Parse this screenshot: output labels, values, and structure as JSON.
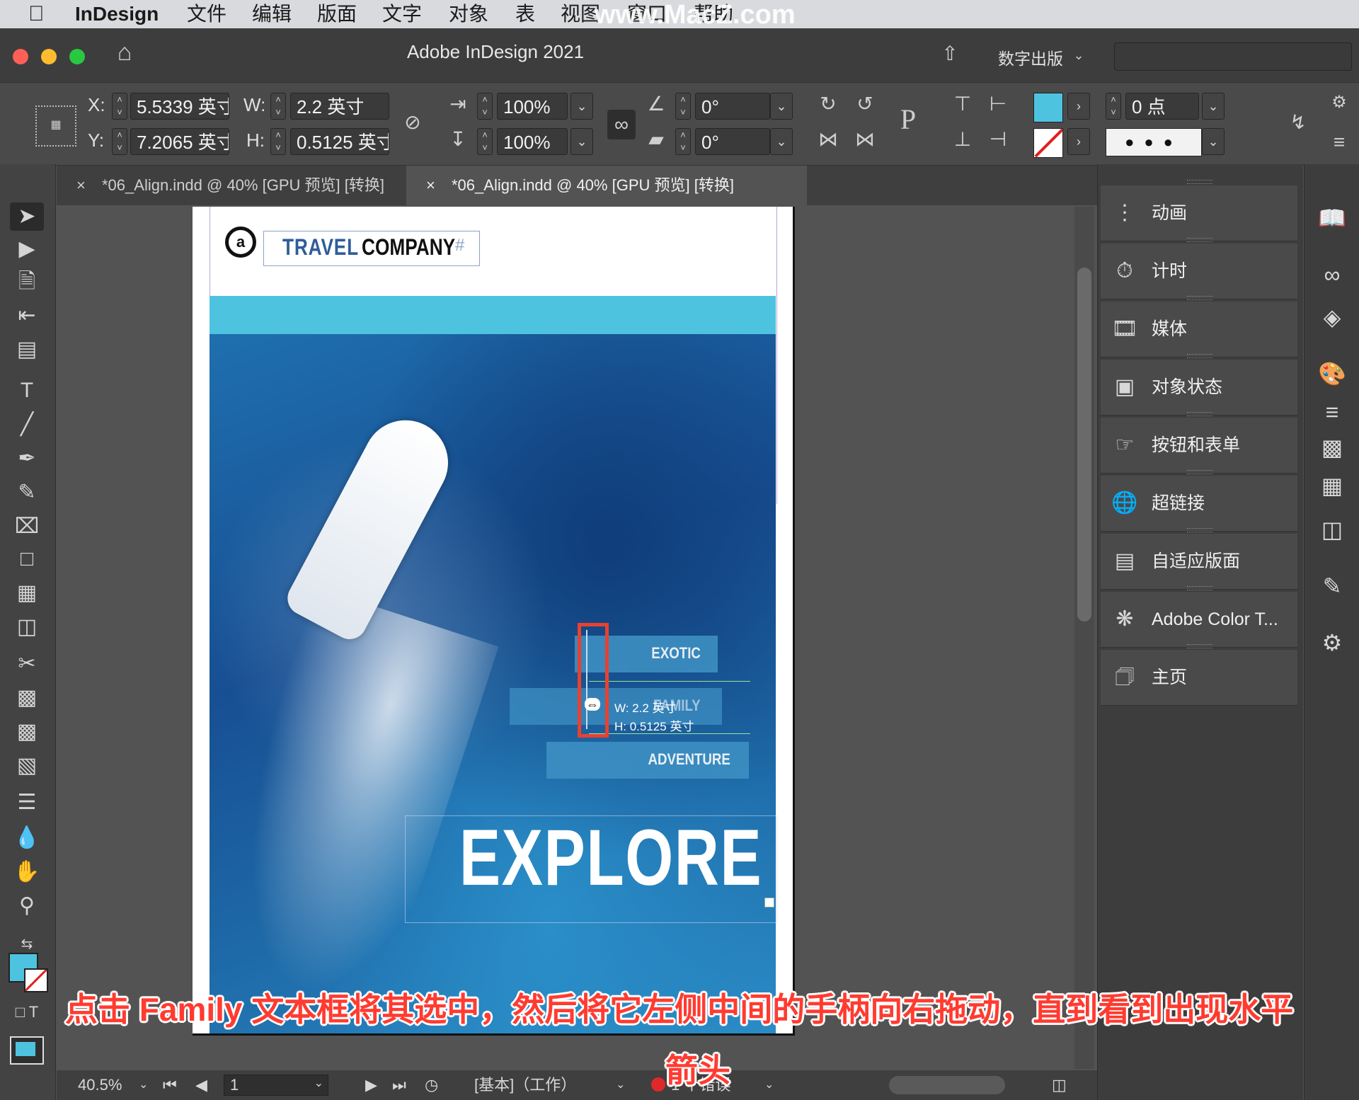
{
  "menubar": {
    "apple": "",
    "app": "InDesign",
    "items": [
      "文件",
      "编辑",
      "版面",
      "文字",
      "对象",
      "表",
      "视图",
      "窗口",
      "帮助"
    ],
    "watermark": "www.MacZ.com"
  },
  "titlebar": {
    "title": "Adobe InDesign 2021",
    "workspace": "数字出版"
  },
  "control": {
    "x_label": "X:",
    "x_value": "5.5339 英寸",
    "y_label": "Y:",
    "y_value": "7.2065 英寸",
    "w_label": "W:",
    "w_value": "2.2 英寸",
    "h_label": "H:",
    "h_value": "0.5125 英寸",
    "scale_x": "100%",
    "scale_y": "100%",
    "rotate": "0°",
    "shear": "0°",
    "stroke_weight": "0 点",
    "fill_color": "#4ec3e0"
  },
  "tabs": [
    {
      "label": "*06_Align.indd @ 40% [GPU 预览] [转换]",
      "close": "×"
    },
    {
      "label": "*06_Align.indd @ 40% [GPU 预览] [转换]",
      "close": "×"
    }
  ],
  "panels": [
    {
      "label": "动画",
      "icon": "animation-icon"
    },
    {
      "label": "计时",
      "icon": "timing-icon"
    },
    {
      "label": "媒体",
      "icon": "media-icon"
    },
    {
      "label": "对象状态",
      "icon": "object-states-icon"
    },
    {
      "label": "按钮和表单",
      "icon": "buttons-forms-icon"
    },
    {
      "label": "超链接",
      "icon": "hyperlinks-icon"
    },
    {
      "label": "自适应版面",
      "icon": "liquid-layout-icon"
    },
    {
      "label": "Adobe Color T...",
      "icon": "adobe-color-icon"
    },
    {
      "label": "主页",
      "icon": "pages-icon"
    }
  ],
  "document": {
    "logo_travel": "TRAVEL",
    "logo_company": "COMPANY",
    "logo_hash": "#",
    "btn_exotic": "EXOTIC",
    "btn_family": "FAMILY",
    "btn_adventure": "ADVENTURE",
    "headline": "EXPLORE",
    "tooltip_w": "W: 2.2 英寸",
    "tooltip_h": "H: 0.5125 英寸",
    "band_color": "#4ec3e0",
    "button_color": "#3d8fc2"
  },
  "statusbar": {
    "zoom": "40.5%",
    "page": "1",
    "style": "[基本]（工作）",
    "errors": "1 个错误"
  },
  "caption": {
    "line1": "点击 Family 文本框将其选中，然后将它左侧中间的手柄向右拖动，直到看到出现水平",
    "line2": "箭头"
  }
}
